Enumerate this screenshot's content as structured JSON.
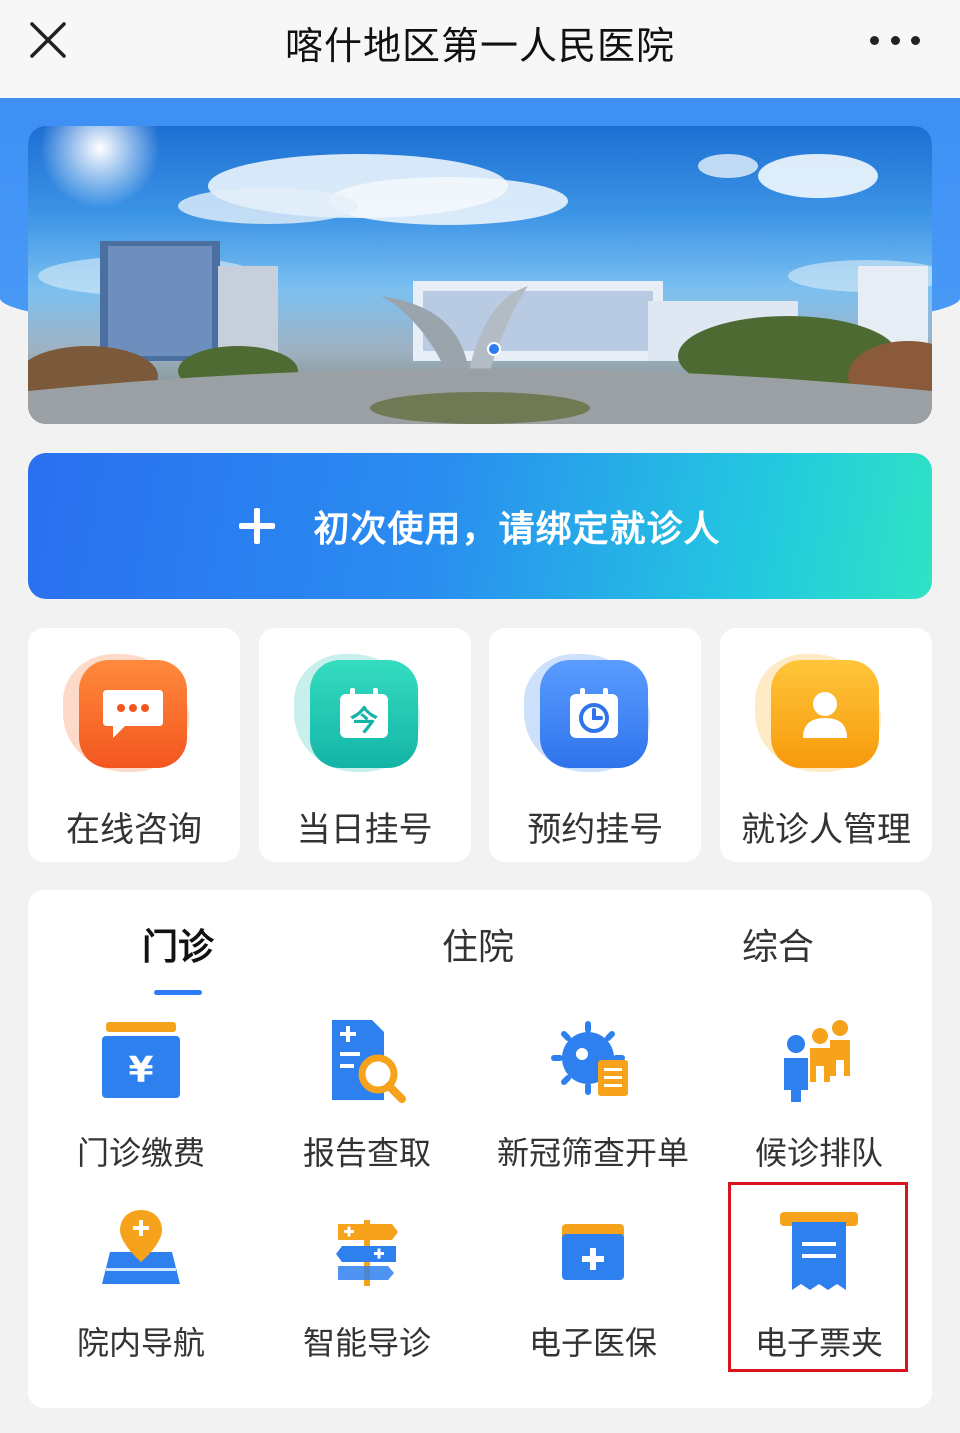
{
  "navbar": {
    "title": "喀什地区第一人民医院",
    "close_icon": "close-icon",
    "more_icon": "more-dots-icon"
  },
  "banner": {
    "description_icon": "hospital-banner-image"
  },
  "bind_button": {
    "label": "初次使用，请绑定就诊人",
    "icon": "plus-icon"
  },
  "quick_actions": [
    {
      "label": "在线咨询",
      "icon": "chat-bubble-icon",
      "color": "#f8672a"
    },
    {
      "label": "当日挂号",
      "icon": "calendar-today-icon",
      "color": "#1fc5b4"
    },
    {
      "label": "预约挂号",
      "icon": "calendar-clock-icon",
      "color": "#3d86f5"
    },
    {
      "label": "就诊人管理",
      "icon": "user-icon",
      "color": "#fbb01c"
    }
  ],
  "tabs": [
    {
      "label": "门诊",
      "active": true
    },
    {
      "label": "住院",
      "active": false
    },
    {
      "label": "综合",
      "active": false
    }
  ],
  "services": [
    {
      "label": "门诊缴费",
      "icon": "yuan-payment-icon"
    },
    {
      "label": "报告查取",
      "icon": "report-search-icon"
    },
    {
      "label": "新冠筛查开单",
      "icon": "virus-document-icon"
    },
    {
      "label": "候诊排队",
      "icon": "queue-people-icon"
    },
    {
      "label": "院内导航",
      "icon": "map-pin-icon"
    },
    {
      "label": "智能导诊",
      "icon": "signpost-icon"
    },
    {
      "label": "电子医保",
      "icon": "medical-card-icon"
    },
    {
      "label": "电子票夹",
      "icon": "receipt-icon"
    }
  ],
  "colors": {
    "primary_blue": "#2e7cf6",
    "highlight_red": "#d9141c"
  }
}
